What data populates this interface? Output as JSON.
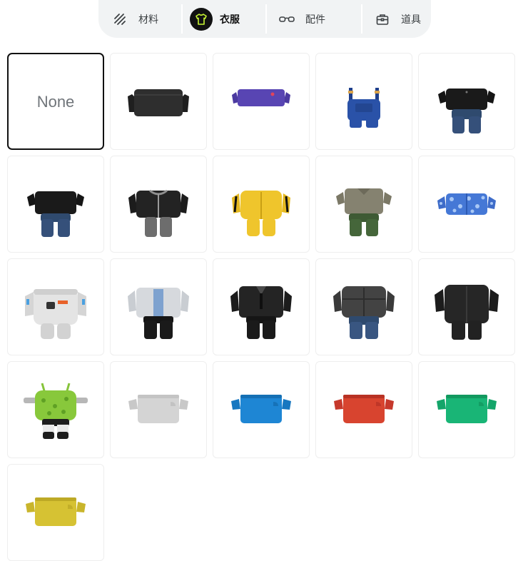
{
  "tabs": [
    {
      "label": "材料",
      "icon": "hatch-stripes-icon",
      "active": false
    },
    {
      "label": "衣服",
      "icon": "tshirt-icon",
      "active": true
    },
    {
      "label": "配件",
      "icon": "glasses-icon",
      "active": false
    },
    {
      "label": "道具",
      "icon": "toolbox-icon",
      "active": false
    }
  ],
  "colors": {
    "active_icon_bg": "#111111",
    "active_icon": "#c6f432",
    "tab_bar_bg": "#f1f3f4"
  },
  "items": [
    {
      "name": "none",
      "label": "None",
      "selected": true
    },
    {
      "name": "black-crop-top"
    },
    {
      "name": "purple-crop-top"
    },
    {
      "name": "denim-overalls"
    },
    {
      "name": "black-tee-jeans"
    },
    {
      "name": "black-tee-jeans-2"
    },
    {
      "name": "zip-hoodie-gray-pants"
    },
    {
      "name": "yellow-tracksuit"
    },
    {
      "name": "khaki-shirt-green-pants"
    },
    {
      "name": "blue-floral-crop-top"
    },
    {
      "name": "white-spacesuit"
    },
    {
      "name": "gray-jacket-black-pants"
    },
    {
      "name": "black-suit-tie"
    },
    {
      "name": "gray-puffer-jeans"
    },
    {
      "name": "black-jumpsuit"
    },
    {
      "name": "green-leaf-top-shorts"
    },
    {
      "name": "white-crop-top"
    },
    {
      "name": "blue-crop-top"
    },
    {
      "name": "red-crop-top"
    },
    {
      "name": "green-crop-top"
    },
    {
      "name": "yellow-crop-top"
    }
  ]
}
